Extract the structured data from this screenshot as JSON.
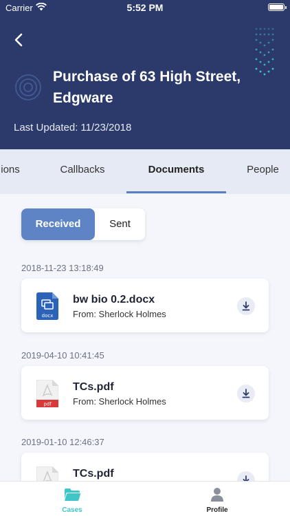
{
  "status_bar": {
    "carrier": "Carrier",
    "time": "5:52 PM"
  },
  "header": {
    "title": "Purchase of 63 High Street, Edgware",
    "updated_label": "Last Updated:",
    "updated_value": "11/23/2018"
  },
  "tabs": [
    {
      "label": "ions"
    },
    {
      "label": "Callbacks"
    },
    {
      "label": "Documents",
      "active": true
    },
    {
      "label": "People"
    }
  ],
  "segmented": {
    "received": "Received",
    "sent": "Sent"
  },
  "documents": [
    {
      "date": "2018-11-23 13:18:49",
      "name": "bw bio 0.2.docx",
      "from": "From: Sherlock Holmes",
      "type": "docx"
    },
    {
      "date": "2019-04-10 10:41:45",
      "name": "TCs.pdf",
      "from": "From: Sherlock Holmes",
      "type": "pdf"
    },
    {
      "date": "2019-01-10 12:46:37",
      "name": "TCs.pdf",
      "from": "",
      "type": "pdf"
    }
  ],
  "bottom_nav": {
    "cases": "Cases",
    "profile": "Profile"
  },
  "colors": {
    "header": "#2c3a6b",
    "accent": "#5f84c6",
    "teal": "#3ec6c9",
    "docx": "#2b63b8",
    "pdf": "#d63a3a"
  }
}
